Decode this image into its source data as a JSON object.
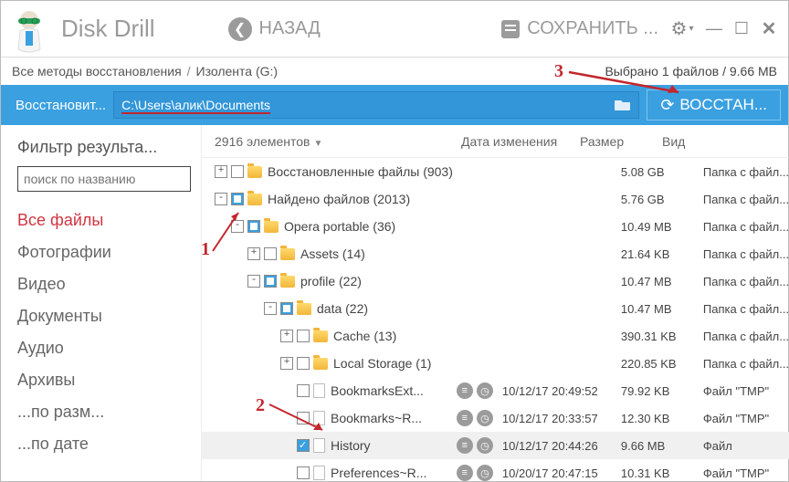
{
  "app": {
    "title": "Disk Drill"
  },
  "titlebar": {
    "back": "НАЗАД",
    "save": "СОХРАНИТЬ ..."
  },
  "breadcrumb": {
    "root": "Все методы восстановления",
    "node": "Изолента (G:)",
    "status": "Выбрано 1 файлов / 9.66 MB"
  },
  "bluebar": {
    "label": "Восстановит...",
    "path": "C:\\Users\\алик\\Documents",
    "button": "ВОССТАН..."
  },
  "sidebar": {
    "header": "Фильтр результа...",
    "search_placeholder": "поиск по названию",
    "items": [
      "Все файлы",
      "Фотографии",
      "Видео",
      "Документы",
      "Аудио",
      "Архивы",
      "...по разм...",
      "...по дате"
    ]
  },
  "columns": {
    "count": "2916 элементов",
    "date": "Дата изменения",
    "size": "Размер",
    "type": "Вид"
  },
  "rows": [
    {
      "indent": 0,
      "toggle": "+",
      "chk": "empty",
      "icon": "folder",
      "name": "Восстановленные файлы (903)",
      "date": "",
      "size": "5.08 GB",
      "type": "Папка с файл..."
    },
    {
      "indent": 0,
      "toggle": "-",
      "chk": "partial",
      "icon": "folder",
      "name": "Найдено файлов (2013)",
      "date": "",
      "size": "5.76 GB",
      "type": "Папка с файл..."
    },
    {
      "indent": 1,
      "toggle": "-",
      "chk": "partial",
      "icon": "folder",
      "name": "Opera portable (36)",
      "date": "",
      "size": "10.49 MB",
      "type": "Папка с файл..."
    },
    {
      "indent": 2,
      "toggle": "+",
      "chk": "empty",
      "icon": "folder",
      "name": "Assets (14)",
      "date": "",
      "size": "21.64 KB",
      "type": "Папка с файл..."
    },
    {
      "indent": 2,
      "toggle": "-",
      "chk": "partial",
      "icon": "folder",
      "name": "profile (22)",
      "date": "",
      "size": "10.47 MB",
      "type": "Папка с файл..."
    },
    {
      "indent": 3,
      "toggle": "-",
      "chk": "partial",
      "icon": "folder",
      "name": "data (22)",
      "date": "",
      "size": "10.47 MB",
      "type": "Папка с файл..."
    },
    {
      "indent": 4,
      "toggle": "+",
      "chk": "empty",
      "icon": "folder",
      "name": "Cache (13)",
      "date": "",
      "size": "390.31 KB",
      "type": "Папка с файл..."
    },
    {
      "indent": 4,
      "toggle": "+",
      "chk": "empty",
      "icon": "folder",
      "name": "Local Storage (1)",
      "date": "",
      "size": "220.85 KB",
      "type": "Папка с файл..."
    },
    {
      "indent": 4,
      "toggle": "",
      "chk": "empty",
      "icon": "file",
      "name": "BookmarksExt...",
      "actions": true,
      "date": "10/12/17 20:49:52",
      "size": "79.92 KB",
      "type": "Файл \"TMP\""
    },
    {
      "indent": 4,
      "toggle": "",
      "chk": "empty",
      "icon": "file",
      "name": "Bookmarks~R...",
      "actions": true,
      "date": "10/12/17 20:33:57",
      "size": "12.30 KB",
      "type": "Файл \"TMP\""
    },
    {
      "indent": 4,
      "toggle": "",
      "chk": "checked",
      "icon": "file",
      "name": "History",
      "actions": true,
      "selected": true,
      "date": "10/12/17 20:44:26",
      "size": "9.66 MB",
      "type": "Файл"
    },
    {
      "indent": 4,
      "toggle": "",
      "chk": "empty",
      "icon": "file",
      "name": "Preferences~R...",
      "actions": true,
      "date": "10/20/17 20:47:15",
      "size": "10.31 KB",
      "type": "Файл \"TMP\""
    }
  ],
  "annotations": {
    "a1": "1",
    "a2": "2",
    "a3": "3"
  }
}
